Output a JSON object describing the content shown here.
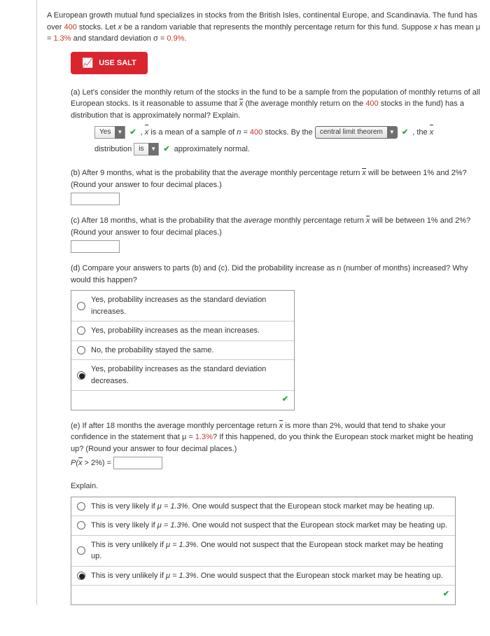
{
  "intro": {
    "line1a": "A European growth mutual fund specializes in stocks from the British Isles, continental Europe, and Scandinavia. The fund has over ",
    "count400": "400",
    "line1b": " stocks. Let ",
    "xvar": "x",
    "line1c": " be a random variable that represents the monthly percentage return for this fund. Suppose ",
    "line1d": " has mean ",
    "mu": "μ = ",
    "muval": "1.3%",
    "line1e": " and standard deviation ",
    "sigma": "σ = ",
    "sigmaval": "0.9%",
    "period": "."
  },
  "salt": {
    "label": "USE SALT"
  },
  "a": {
    "text1": "(a) Let's consider the monthly return of the stocks in the fund to be a sample from the population of monthly returns of all European stocks. Is it reasonable to assume that ",
    "xvar": "x",
    "text2": " (the average monthly return on the ",
    "count400": "400",
    "text3": " stocks in the fund) has a distribution that is approximately normal? Explain.",
    "dd_yes": "Yes",
    "seg1a": ", ",
    "seg1b": " is a mean of a sample of ",
    "neq": "n = ",
    "n400": "400",
    "seg1c": " stocks. By the ",
    "clt": "central limit theorem",
    "seg1d": ", the ",
    "seg2a": "distribution ",
    "dd_is": "is",
    "seg2b": " approximately normal."
  },
  "b": {
    "text1": "(b) After 9 months, what is the probability that the ",
    "avg": "average",
    "text2": " monthly percentage return ",
    "text3": " will be between 1% and 2%? (Round your answer to four decimal places.)"
  },
  "c": {
    "text1": "(c) After 18 months, what is the probability that the ",
    "avg": "average",
    "text2": " monthly percentage return ",
    "text3": " will be between 1% and 2%? (Round your answer to four decimal places.)"
  },
  "d": {
    "prompt": "(d) Compare your answers to parts (b) and (c). Did the probability increase as n (number of months) increased? Why would this happen?",
    "opt1": "Yes, probability increases as the standard deviation increases.",
    "opt2": "Yes, probability increases as the mean increases.",
    "opt3": "No, the probability stayed the same.",
    "opt4": "Yes, probability increases as the standard deviation decreases."
  },
  "e": {
    "text1": "(e) If after 18 months the average monthly percentage return ",
    "text2": " is more than 2%, would that tend to shake your confidence in the statement that ",
    "mu": "μ = ",
    "muval": "1.3%",
    "text3": "? If this happened, do you think the European stock market might be heating up? (Round your answer to four decimal places.)",
    "eq": "P(",
    "eq2": " > 2%) = ",
    "explain": "Explain.",
    "opt1a": "This is very likely if ",
    "opt1b": ". One would suspect that the European stock market may be heating up.",
    "opt2a": "This is very likely if ",
    "opt2b": ". One would not suspect that the European stock market may be heating up.",
    "opt3a": "This is very unlikely if ",
    "opt3b": ". One would not suspect that the European stock market may be heating up.",
    "opt4a": "This is very unlikely if ",
    "opt4b": ". One would suspect that the European stock market may be heating up.",
    "mueq": "μ = 1.3%"
  }
}
